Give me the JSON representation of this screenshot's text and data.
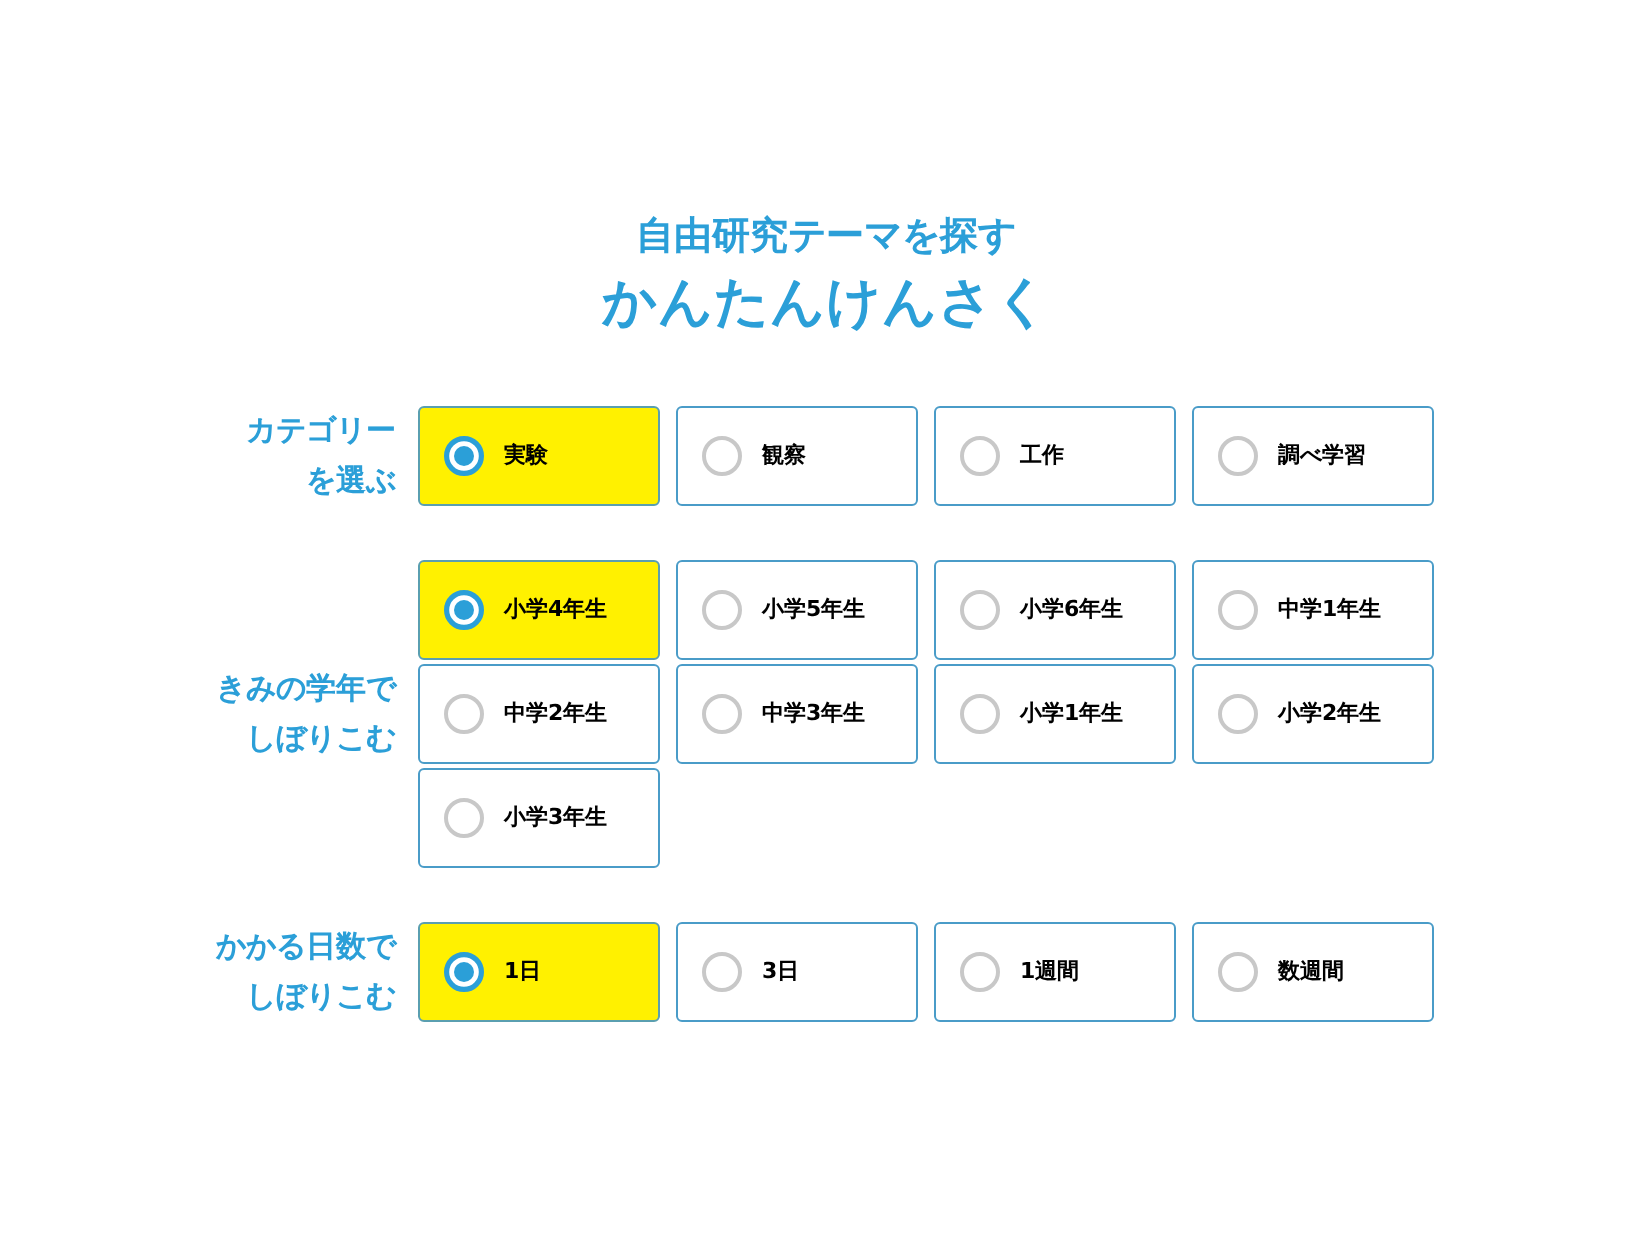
{
  "header": {
    "title": "自由研究テーマを探す",
    "subtitle": "かんたんけんさく"
  },
  "filters": [
    {
      "label_lines": [
        "カテゴリー",
        "を選ぶ"
      ],
      "options": [
        {
          "label": "実験",
          "selected": true
        },
        {
          "label": "観察",
          "selected": false
        },
        {
          "label": "工作",
          "selected": false
        },
        {
          "label": "調べ学習",
          "selected": false
        }
      ]
    },
    {
      "label_lines": [
        "きみの学年で",
        "しぼりこむ"
      ],
      "options": [
        {
          "label": "小学4年生",
          "selected": true
        },
        {
          "label": "小学5年生",
          "selected": false
        },
        {
          "label": "小学6年生",
          "selected": false
        },
        {
          "label": "中学1年生",
          "selected": false
        },
        {
          "label": "中学2年生",
          "selected": false
        },
        {
          "label": "中学3年生",
          "selected": false
        },
        {
          "label": "小学1年生",
          "selected": false
        },
        {
          "label": "小学2年生",
          "selected": false
        },
        {
          "label": "小学3年生",
          "selected": false
        }
      ]
    },
    {
      "label_lines": [
        "かかる日数で",
        "しぼりこむ"
      ],
      "options": [
        {
          "label": "1日",
          "selected": true
        },
        {
          "label": "3日",
          "selected": false
        },
        {
          "label": "1週間",
          "selected": false
        },
        {
          "label": "数週間",
          "selected": false
        }
      ]
    }
  ]
}
